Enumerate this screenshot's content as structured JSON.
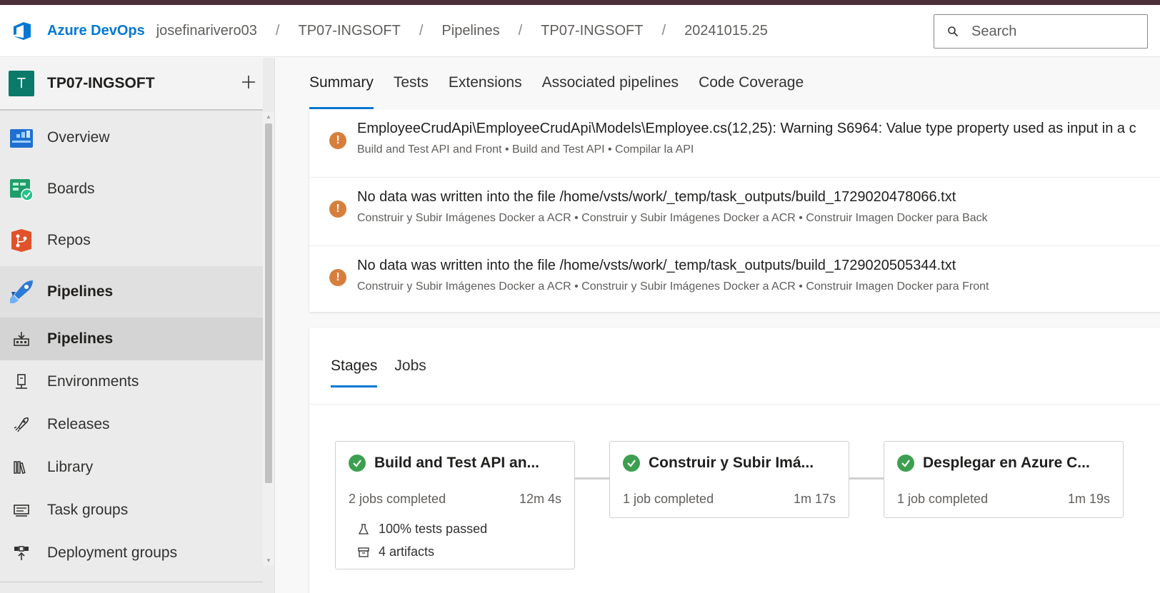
{
  "header": {
    "brand": "Azure DevOps",
    "breadcrumbs": [
      "josefinarivero03",
      "TP07-INGSOFT",
      "Pipelines",
      "TP07-INGSOFT",
      "20241015.25"
    ],
    "separator": "/",
    "search_placeholder": "Search"
  },
  "sidebar": {
    "project_initial": "T",
    "project_name": "TP07-INGSOFT",
    "add_symbol": "+",
    "items": [
      {
        "label": "Overview",
        "icon": "overview-icon"
      },
      {
        "label": "Boards",
        "icon": "boards-icon"
      },
      {
        "label": "Repos",
        "icon": "repos-icon"
      },
      {
        "label": "Pipelines",
        "icon": "pipelines-icon"
      }
    ],
    "subitems": [
      {
        "label": "Pipelines",
        "icon": "pipelines-sub-icon"
      },
      {
        "label": "Environments",
        "icon": "environments-icon"
      },
      {
        "label": "Releases",
        "icon": "releases-icon"
      },
      {
        "label": "Library",
        "icon": "library-icon"
      },
      {
        "label": "Task groups",
        "icon": "task-groups-icon"
      },
      {
        "label": "Deployment groups",
        "icon": "deployment-groups-icon"
      }
    ]
  },
  "tabs": [
    "Summary",
    "Tests",
    "Extensions",
    "Associated pipelines",
    "Code Coverage"
  ],
  "issues": [
    {
      "message": "EmployeeCrudApi\\EmployeeCrudApi\\Models\\Employee.cs(12,25): Warning S6964: Value type property used as input in a c",
      "path": "Build and Test API and Front • Build and Test API • Compilar la API"
    },
    {
      "message": "No data was written into the file /home/vsts/work/_temp/task_outputs/build_1729020478066.txt",
      "path": "Construir y Subir Imágenes Docker a ACR • Construir y Subir Imágenes Docker a ACR • Construir Imagen Docker para Back"
    },
    {
      "message": "No data was written into the file /home/vsts/work/_temp/task_outputs/build_1729020505344.txt",
      "path": "Construir y Subir Imágenes Docker a ACR • Construir y Subir Imágenes Docker a ACR • Construir Imagen Docker para Front"
    }
  ],
  "stage_tabs": [
    "Stages",
    "Jobs"
  ],
  "stages": [
    {
      "title": "Build and Test API an...",
      "jobs": "2 jobs completed",
      "duration": "12m 4s",
      "tests": "100% tests passed",
      "artifacts": "4 artifacts"
    },
    {
      "title": "Construir y Subir Imá...",
      "jobs": "1 job completed",
      "duration": "1m 17s"
    },
    {
      "title": "Desplegar en Azure C...",
      "jobs": "1 job completed",
      "duration": "1m 19s"
    }
  ],
  "colors": {
    "accent": "#0078d4",
    "warning": "#d67f3c",
    "success": "#3d9f50",
    "project_avatar": "#0b7a6a"
  }
}
